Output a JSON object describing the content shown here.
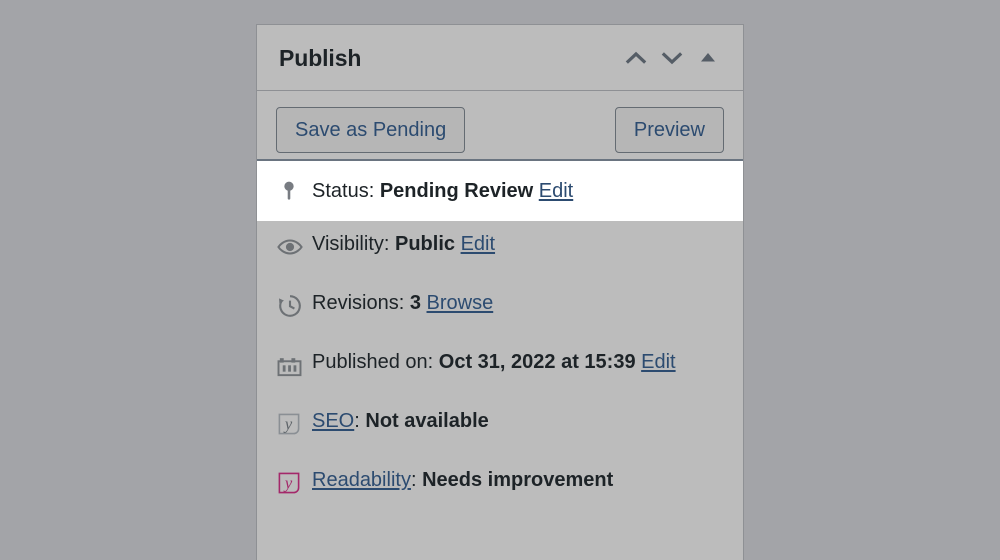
{
  "panel": {
    "title": "Publish",
    "header_controls": [
      {
        "name": "move-up-icon",
        "glyph": "chevron-up"
      },
      {
        "name": "move-down-icon",
        "glyph": "chevron-down"
      },
      {
        "name": "toggle-panel-icon",
        "glyph": "triangle-up"
      }
    ],
    "buttons": {
      "save_label": "Save as Pending",
      "preview_label": "Preview"
    },
    "rows": [
      {
        "id": "status",
        "icon": "post-status-pin-icon",
        "label": "Status:",
        "value": "Pending Review",
        "action": "Edit",
        "highlighted": true
      },
      {
        "id": "visibility",
        "icon": "visibility-eye-icon",
        "label": "Visibility:",
        "value": "Public",
        "action": "Edit",
        "highlighted": false
      },
      {
        "id": "revisions",
        "icon": "revisions-clock-icon",
        "label": "Revisions:",
        "value": "3",
        "action": "Browse",
        "highlighted": false
      },
      {
        "id": "published-on",
        "icon": "calendar-icon",
        "label": "Published on:",
        "value": "Oct 31, 2022 at 15:39",
        "action": "Edit",
        "highlighted": false
      },
      {
        "id": "seo",
        "icon": "yoast-seo-icon-gray",
        "link_label": "SEO",
        "separator": ":",
        "value": "Not available",
        "highlighted": false
      },
      {
        "id": "readability",
        "icon": "yoast-readability-icon-red",
        "link_label": "Readability",
        "separator": ":",
        "value": "Needs improvement",
        "highlighted": false
      }
    ]
  },
  "colors": {
    "page_background": "#a3a4a8",
    "panel_background": "#bcbcbc",
    "panel_border": "#8e9094",
    "link": "#2c4b70",
    "text": "#1d2327",
    "highlight_row_background": "#ffffff",
    "highlight_row_border": "#6a7480",
    "icon_gray": "#787c82",
    "yoast_red": "#a4286a"
  }
}
